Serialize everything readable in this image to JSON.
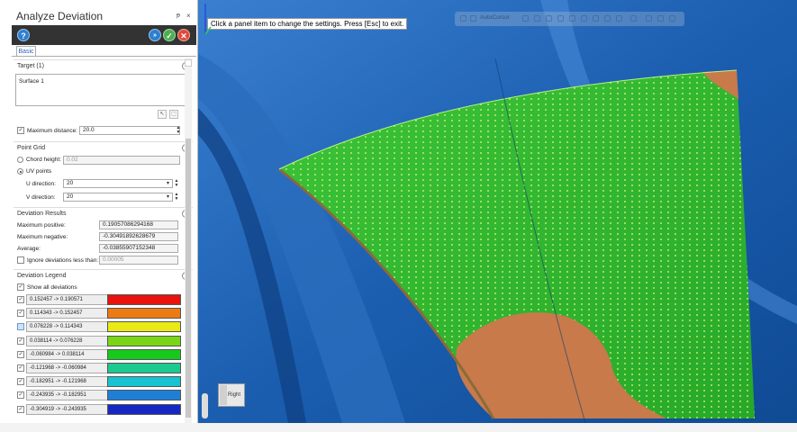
{
  "panel": {
    "title": "Analyze Deviation",
    "pin_glyph": "ᵽ",
    "close_glyph": "×",
    "toolbar": {
      "help_icon": "?",
      "apply_icon": "»",
      "ok_icon": "✓",
      "cancel_icon": "✕"
    },
    "tab": "Basic",
    "target": {
      "header": "Target (1)",
      "items": [
        "Surface 1"
      ],
      "max_distance_label": "Maximum distance:",
      "max_distance_value": "20.0",
      "max_distance_checked": true
    },
    "point_grid": {
      "header": "Point Grid",
      "chord_label": "Chord height:",
      "chord_value": "0.02",
      "uv_label": "UV points",
      "u_label": "U direction:",
      "u_value": "20",
      "v_label": "V direction:",
      "v_value": "20",
      "selected": "uv"
    },
    "results": {
      "header": "Deviation Results",
      "max_pos_label": "Maximum positive:",
      "max_pos_value": "0.19057086294168",
      "max_neg_label": "Maximum negative:",
      "max_neg_value": "-0.30491892628679",
      "avg_label": "Average:",
      "avg_value": "-0.03855907152348",
      "ignore_label": "Ignore deviations less than:",
      "ignore_value": "0.00005",
      "ignore_checked": false
    },
    "legend": {
      "header": "Deviation Legend",
      "show_all_label": "Show all deviations",
      "show_all_checked": true,
      "rows": [
        {
          "range": "0.152457 -> 0.190571",
          "color": "#e8120e",
          "checked": true
        },
        {
          "range": "0.114343 -> 0.152457",
          "color": "#ee7a12",
          "checked": true
        },
        {
          "range": "0.076228 -> 0.114343",
          "color": "#e9e915",
          "checked": false
        },
        {
          "range": "0.038114 -> 0.076228",
          "color": "#7ad614",
          "checked": true
        },
        {
          "range": "-0.060984 -> 0.038114",
          "color": "#17c91c",
          "checked": true
        },
        {
          "range": "-0.121968 -> -0.060984",
          "color": "#1cc98e",
          "checked": true
        },
        {
          "range": "-0.182951 -> -0.121968",
          "color": "#17c3d0",
          "checked": true
        },
        {
          "range": "-0.243935 -> -0.182951",
          "color": "#1f7fd6",
          "checked": true
        },
        {
          "range": "-0.304919 -> -0.243935",
          "color": "#1628c4",
          "checked": true
        }
      ]
    }
  },
  "viewport": {
    "hint": "Click a panel item to change the settings. Press [Esc] to exit.",
    "qat_label": "AutoCursor",
    "viewcube_face": "Right"
  }
}
